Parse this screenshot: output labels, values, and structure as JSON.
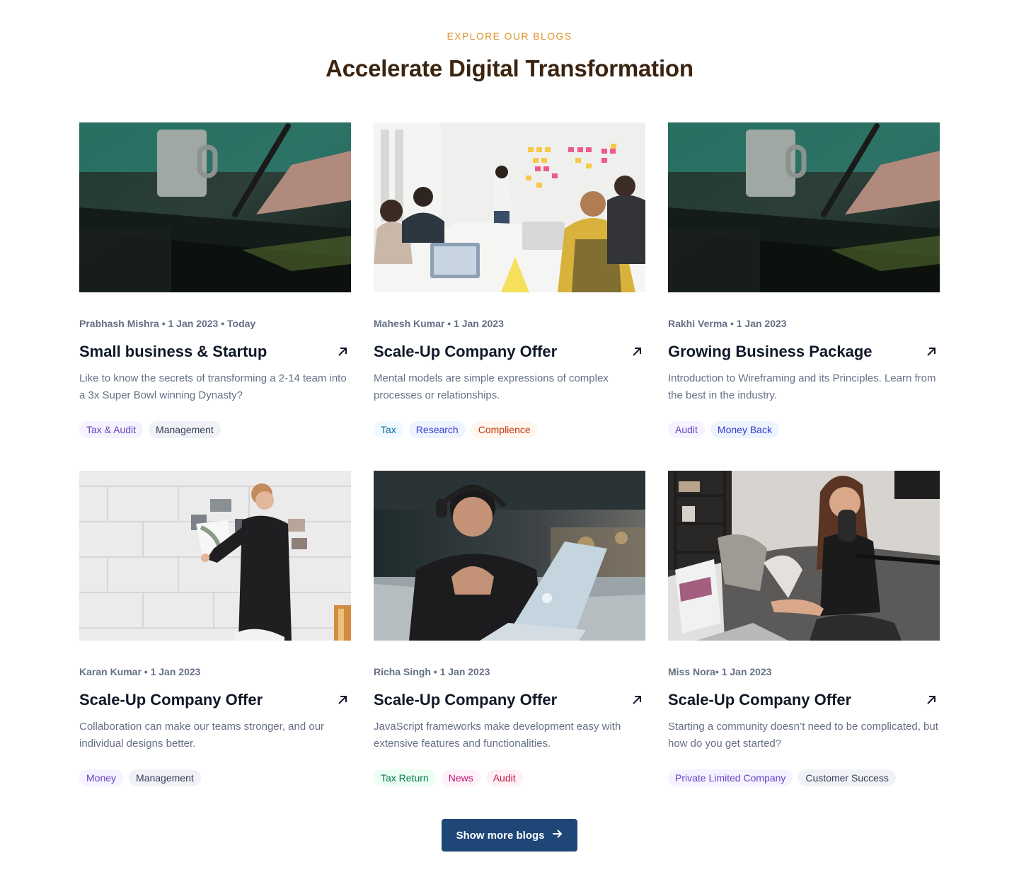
{
  "section": {
    "eyebrow": "EXPLORE OUR BLOGS",
    "title": "Accelerate Digital Transformation"
  },
  "posts": [
    {
      "meta": "Prabhash Mishra • 1 Jan 2023 • Today",
      "title": "Small business & Startup",
      "description": "Like to know the secrets of transforming a 2-14 team into a 3x Super Bowl winning Dynasty?",
      "tags": [
        "Tax & Audit",
        "Management"
      ],
      "image": "hand-stylus-tablet-photo"
    },
    {
      "meta": "Mahesh Kumar • 1 Jan 2023",
      "title": "Scale-Up Company Offer",
      "description": "Mental models are simple expressions of complex processes or relationships.",
      "tags": [
        "Tax",
        "Research",
        "Complience"
      ],
      "image": "team-meeting-whiteboard-photo"
    },
    {
      "meta": "Rakhi Verma • 1 Jan 2023",
      "title": "Growing Business Package",
      "description": "Introduction to Wireframing and its Principles. Learn from the best in the industry.",
      "tags": [
        "Audit",
        "Money Back"
      ],
      "image": "hand-stylus-tablet-photo"
    },
    {
      "meta": "Karan Kumar • 1 Jan 2023",
      "title": "Scale-Up Company Offer",
      "description": "Collaboration can make our teams stronger, and our individual designs better.",
      "tags": [
        "Money",
        "Management"
      ],
      "image": "man-pinning-photos-wall-photo"
    },
    {
      "meta": "Richa Singh • 1 Jan 2023",
      "title": "Scale-Up Company Offer",
      "description": "JavaScript frameworks make development easy with extensive features and functionalities.",
      "tags": [
        "Tax Return",
        "News",
        "Audit"
      ],
      "image": "man-headphones-laptop-photo"
    },
    {
      "meta": "Miss Nora• 1 Jan 2023",
      "title": "Scale-Up Company Offer",
      "description": "Starting a community doesn’t need to be complicated, but how do you get started?",
      "tags": [
        "Private Limited Company",
        "Customer Success"
      ],
      "image": "woman-podcast-microphone-photo"
    }
  ],
  "cta": {
    "label": "Show more blogs",
    "icon": "arrow-right-icon"
  },
  "colors": {
    "eyebrow": "#e0952f",
    "headline": "#3b2410",
    "button": "#1e4676"
  }
}
